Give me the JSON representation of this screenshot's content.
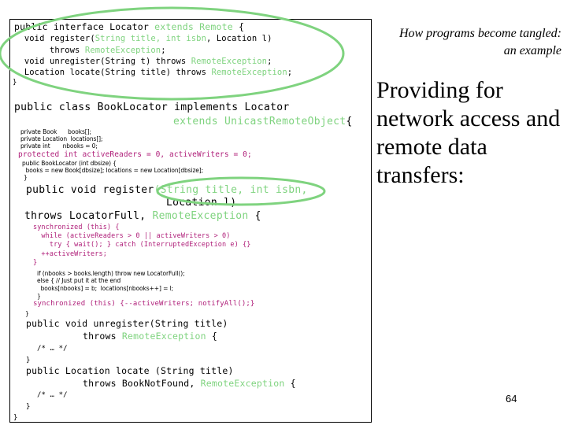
{
  "slide": {
    "subtitle_line1": "How programs become tangled:",
    "subtitle_line2": "an example",
    "headline_line1": "Providing for",
    "headline_line2": "network access and",
    "headline_line3": "remote data transfers:",
    "page_number": "64",
    "highlight_color": "#7fd37f",
    "sync_color": "#b0207a"
  },
  "code": {
    "iface": {
      "l1a": "public interface Locator ",
      "l1b": "extends Remote",
      "l1c": " {",
      "l2a": "  void register(",
      "l2b": "String title, int isbn",
      "l2c": ", Location l)",
      "l3a": "       throws ",
      "l3b": "RemoteException",
      "l3c": ";",
      "l4a": "  void unregister(String t) throws ",
      "l4b": "RemoteException",
      "l4c": ";",
      "l5a": "  Location locate(String title) throws ",
      "l5b": "RemoteException",
      "l5c": ";",
      "l6": "}"
    },
    "cls": {
      "l1": "public class BookLocator implements Locator",
      "l2a": "extends UnicastRemoteObject",
      "l2b": "{",
      "f1": "private Book      books[];",
      "f2": "private Location  locations[];",
      "f3": "private int       nbooks = 0;",
      "f4": "protected int activeReaders = 0, activeWriters = 0;",
      "c1": "public BookLocator (int dbsize) {",
      "c2": "  books = new Book[dbsize]; locations = new Location[dbsize];",
      "c3": "}",
      "r1a": "public void register",
      "r1b": "(String title, int isbn,",
      "r2": "Location l)",
      "r3a": "throws LocatorFull, ",
      "r3b": "RemoteException",
      "r3c": " {",
      "s1": "synchronized (this) {",
      "s2": "  while (activeReaders > 0 || activeWriters > 0)",
      "s3": "    try { wait(); } catch (InterruptedException e) {}",
      "s4": "  ++activeWriters;",
      "s5": "}",
      "b1": "if (nbooks > books.length) throw new LocatorFull();",
      "b2": "else { // Just put it at the end",
      "b3": "  books[nbooks] = b;  locations[nbooks++] = l;",
      "b4": "}",
      "s6": "synchronized (this) {--activeWriters; notifyAll();}",
      "r4": "}",
      "u1": "public void unregister(String title)",
      "u2a": "throws ",
      "u2b": "RemoteException",
      "u2c": " {",
      "u3": "/* … */",
      "u4": "}",
      "x1": "public Location locate (String title)",
      "x2a": "throws BookNotFound, ",
      "x2b": "RemoteException",
      "x2c": " {",
      "x3": "/* … */",
      "x4": "}",
      "end": "}"
    }
  }
}
